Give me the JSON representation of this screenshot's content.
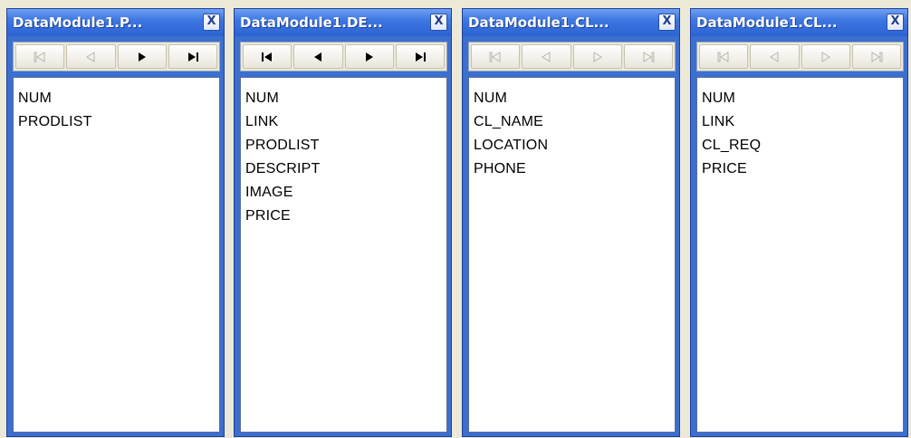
{
  "windows": [
    {
      "title": "DataModule1.P...",
      "close_label": "X",
      "nav": {
        "first_enabled": false,
        "prior_enabled": false,
        "next_enabled": true,
        "last_enabled": true
      },
      "fields": [
        "NUM",
        "PRODLIST"
      ]
    },
    {
      "title": "DataModule1.DE...",
      "close_label": "X",
      "nav": {
        "first_enabled": true,
        "prior_enabled": true,
        "next_enabled": true,
        "last_enabled": true
      },
      "fields": [
        "NUM",
        "LINK",
        "PRODLIST",
        "DESCRIPT",
        "IMAGE",
        "PRICE"
      ]
    },
    {
      "title": "DataModule1.CL...",
      "close_label": "X",
      "nav": {
        "first_enabled": false,
        "prior_enabled": false,
        "next_enabled": false,
        "last_enabled": false
      },
      "fields": [
        "NUM",
        "CL_NAME",
        "LOCATION",
        "PHONE"
      ]
    },
    {
      "title": "DataModule1.CL...",
      "close_label": "X",
      "nav": {
        "first_enabled": false,
        "prior_enabled": false,
        "next_enabled": false,
        "last_enabled": false
      },
      "fields": [
        "NUM",
        "LINK",
        "CL_REQ",
        "PRICE"
      ]
    }
  ],
  "icons": {
    "first": "first-record-icon",
    "prior": "prior-record-icon",
    "next": "next-record-icon",
    "last": "last-record-icon"
  },
  "colors": {
    "titlebar": "#2c63d3",
    "frame": "#3b6fd0",
    "background": "#ece9d8"
  }
}
